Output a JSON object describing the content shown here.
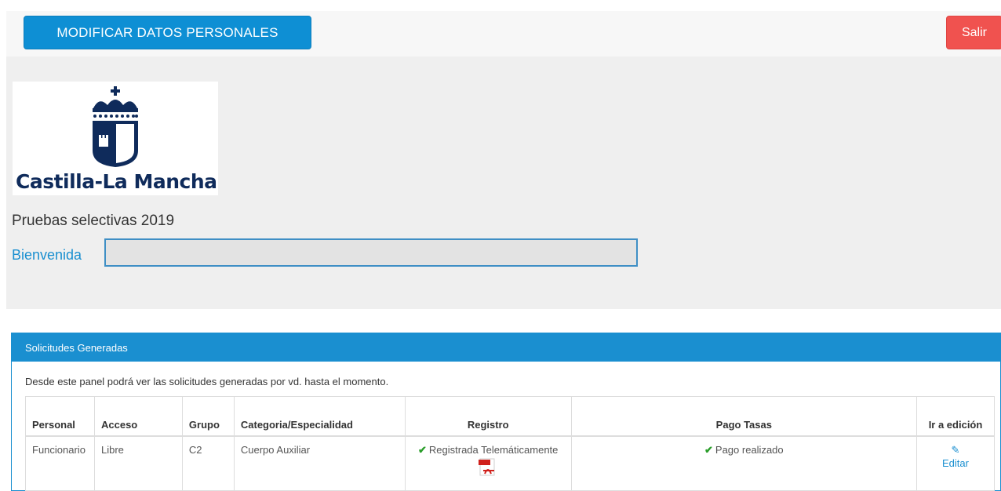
{
  "topbar": {
    "modify_label": "MODIFICAR DATOS PERSONALES",
    "exit_label": "Salir"
  },
  "brand": {
    "logo_text": "Castilla-La Mancha",
    "logo_color": "#0f2b5b"
  },
  "hero": {
    "subtitle": "Pruebas selectivas 2019",
    "welcome_label": "Bienvenida",
    "name_value": ""
  },
  "panel": {
    "title": "Solicitudes Generadas",
    "description": "Desde este panel podrá ver las solicitudes generadas por vd. hasta el momento.",
    "headers": [
      "Personal",
      "Acceso",
      "Grupo",
      "Categoria/Especialidad",
      "Registro",
      "Pago Tasas",
      "Ir a edición"
    ],
    "rows": [
      {
        "personal": "Funcionario",
        "acceso": "Libre",
        "grupo": "C2",
        "categoria": "Cuerpo Auxiliar",
        "registro": "Registrada Telemáticamente",
        "registro_icon": "pdf-icon",
        "pago": "Pago realizado",
        "editar": "Editar"
      }
    ]
  },
  "colors": {
    "primary": "#1a8fd0",
    "danger": "#f0524f",
    "success": "#2a9d2a"
  }
}
